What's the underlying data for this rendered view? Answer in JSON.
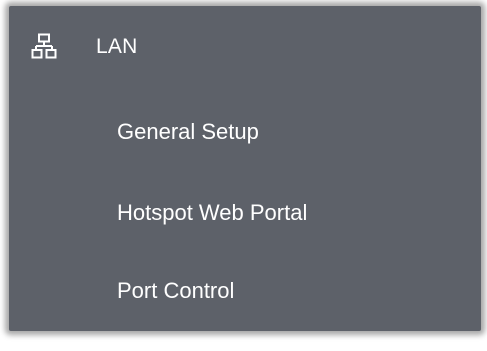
{
  "menu": {
    "section": {
      "icon": "network-lan-icon",
      "label": "LAN"
    },
    "items": [
      {
        "label": "General Setup"
      },
      {
        "label": "Hotspot Web Portal"
      },
      {
        "label": "Port Control"
      }
    ]
  },
  "colors": {
    "panel_background": "#5d6169",
    "text": "#ffffff"
  }
}
